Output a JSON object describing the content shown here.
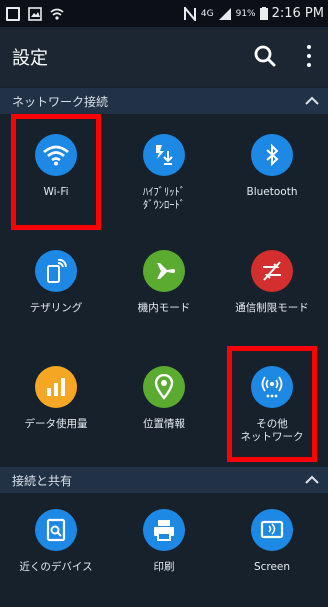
{
  "status_bar": {
    "signal_type": "4G",
    "battery_percent": "91%",
    "time": "2:16 PM",
    "icons": [
      "gallery-icon",
      "photo-icon",
      "wifi-signal-icon",
      "nfc-icon",
      "cell-signal-icon",
      "battery-icon"
    ]
  },
  "app_bar": {
    "title": "設定"
  },
  "sections": [
    {
      "title": "ネットワーク接続",
      "expanded": true
    },
    {
      "title": "接続と共有",
      "expanded": true
    }
  ],
  "network_tiles": [
    {
      "label": "Wi-Fi",
      "color": "#1e88e5",
      "icon": "wifi-icon",
      "highlighted": true
    },
    {
      "label": "ﾊｲﾌﾞﾘｯﾄﾞ\nﾀﾞｳﾝﾛｰﾄﾞ",
      "color": "#1e88e5",
      "icon": "hybrid-download-icon",
      "highlighted": false
    },
    {
      "label": "Bluetooth",
      "color": "#1e88e5",
      "icon": "bluetooth-icon",
      "highlighted": false
    },
    {
      "label": "テザリング",
      "color": "#1e88e5",
      "icon": "tethering-icon",
      "highlighted": false
    },
    {
      "label": "機内モード",
      "color": "#5aab2f",
      "icon": "airplane-icon",
      "highlighted": false
    },
    {
      "label": "通信制限モード",
      "color": "#d32f2f",
      "icon": "data-limit-icon",
      "highlighted": false
    },
    {
      "label": "データ使用量",
      "color": "#f5a623",
      "icon": "data-usage-icon",
      "highlighted": false
    },
    {
      "label": "位置情報",
      "color": "#5aab2f",
      "icon": "location-icon",
      "highlighted": false
    },
    {
      "label": "その他\nネットワーク",
      "color": "#1e88e5",
      "icon": "more-networks-icon",
      "highlighted": true
    }
  ],
  "share_tiles": [
    {
      "label": "近くのデバイス",
      "color": "#1e88e5",
      "icon": "nearby-devices-icon"
    },
    {
      "label": "印刷",
      "color": "#1e88e5",
      "icon": "print-icon"
    },
    {
      "label": "Screen",
      "color": "#1e88e5",
      "icon": "screen-mirroring-icon"
    }
  ],
  "colors": {
    "background": "#16212c",
    "header": "#223246",
    "highlight": "#ff0000"
  }
}
